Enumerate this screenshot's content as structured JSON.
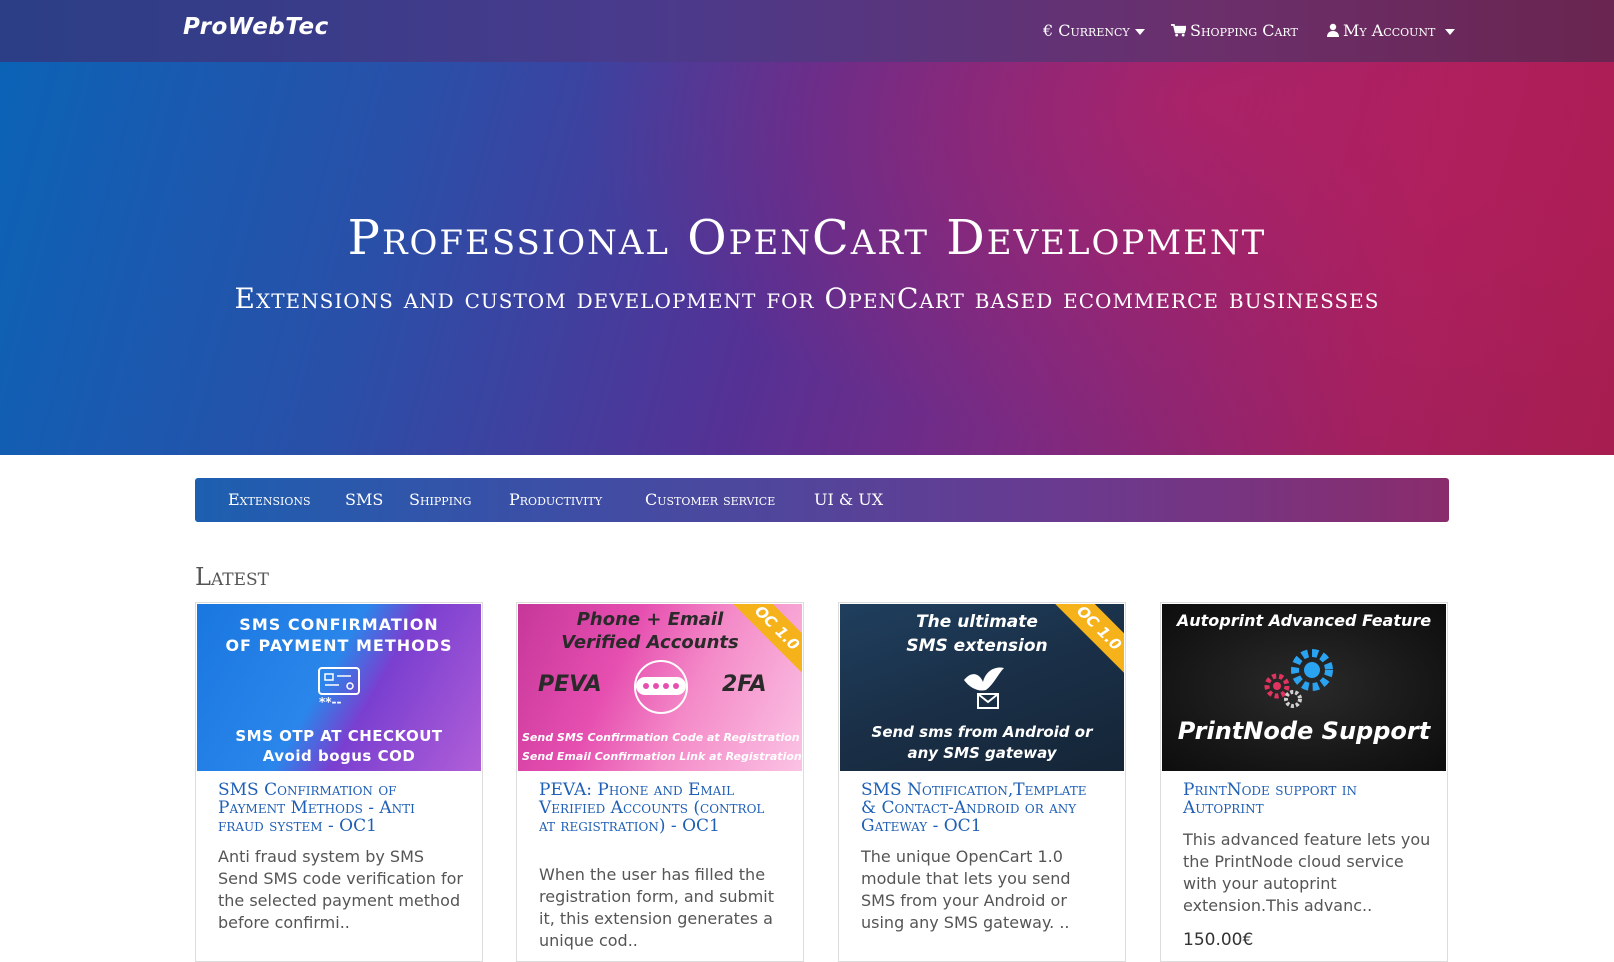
{
  "brand": {
    "logo": "ProWebTec"
  },
  "topnav": {
    "currency": "€ Currency",
    "cart": "Shopping Cart",
    "account": "My Account"
  },
  "hero": {
    "title": "Professional OpenCart Development",
    "subtitle": "Extensions and custom development for OpenCart based ecommerce businesses"
  },
  "categories": [
    "Extensions",
    "SMS",
    "Shipping",
    "Productivity",
    "Customer service",
    "UI & UX"
  ],
  "latest": {
    "heading": "Latest",
    "products": [
      {
        "title": "SMS Confirmation of Payment Methods - Anti fraud system - OC1",
        "description": "Anti fraud system by SMS Send SMS code verification for the selected payment method before confirmi..",
        "price": "",
        "image_lines": [
          "SMS CONFIRMATION",
          "OF PAYMENT METHODS",
          "SMS OTP AT CHECKOUT",
          "Avoid bogus COD"
        ]
      },
      {
        "title": "PEVA: Phone and Email Verified Accounts (control at registration) - OC1",
        "description": "When the user has filled the registration form, and submit it, this extension generates a unique cod..",
        "price": "",
        "image_lines": [
          "Phone + Email",
          "Verified Accounts",
          "PEVA",
          "2FA",
          "Send SMS Confirmation Code at Registration",
          "Send Email Confirmation Link at Registration"
        ],
        "badge": "OC 1.0"
      },
      {
        "title": "SMS Notification,Template & Contact-Android or any Gateway - OC1",
        "description": "The unique OpenCart 1.0 module that lets you send SMS from your Android or using any SMS gateway. ..",
        "price": "",
        "image_lines": [
          "The ultimate",
          "SMS extension",
          "Send sms from Android or",
          "any SMS gateway"
        ],
        "badge": "OC 1.0"
      },
      {
        "title": "PrintNode support in Autoprint",
        "description": "This advanced feature lets you the PrintNode cloud service with your autoprint extension.This advanc..",
        "price": "150.00€",
        "image_lines": [
          "Autoprint Advanced Feature",
          "PrintNode Support"
        ]
      }
    ]
  },
  "colors": {
    "accent_blue": "#1f5fb5",
    "badge_orange": "#f5b21b"
  }
}
